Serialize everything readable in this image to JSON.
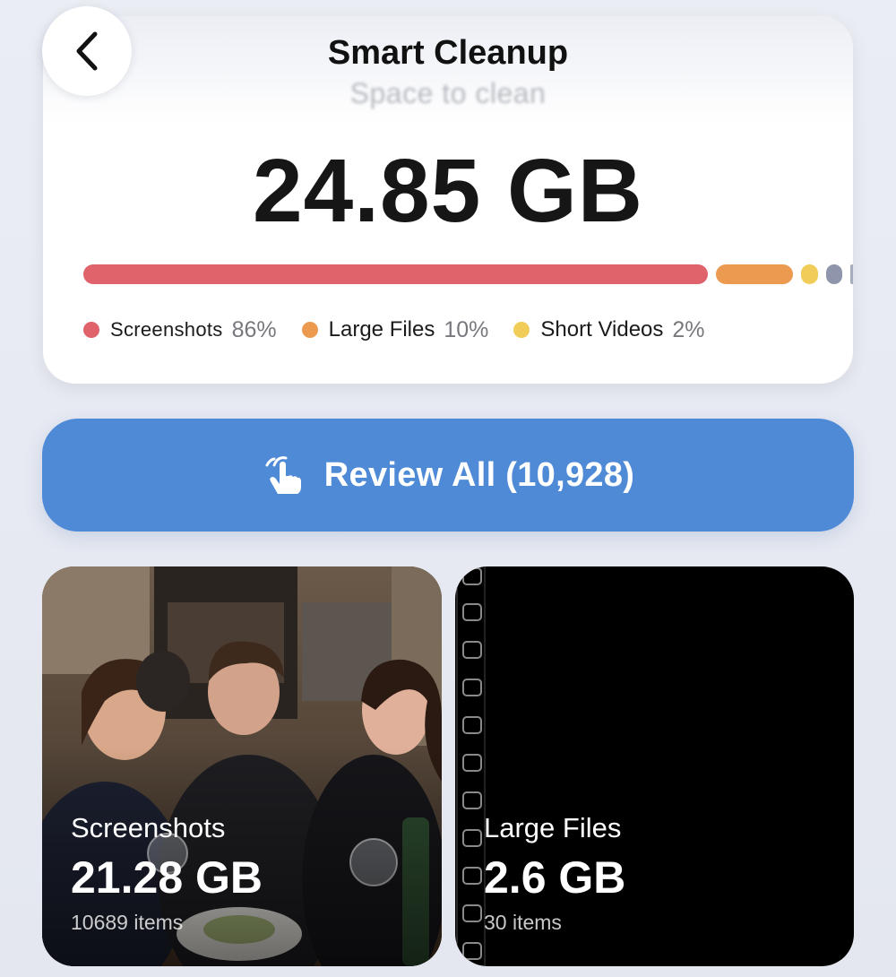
{
  "header": {
    "title": "Smart Cleanup",
    "back_icon": "chevron-left-icon"
  },
  "summary": {
    "subtitle": "Space to clean",
    "total": "24.85 GB",
    "breakdown": [
      {
        "name": "Screenshots",
        "percent": "86%",
        "color": "#e0626a"
      },
      {
        "name": "Large Files",
        "percent": "10%",
        "color": "#ec9a4f"
      },
      {
        "name": "Short Videos",
        "percent": "2%",
        "color": "#f1cc59"
      }
    ],
    "extra_segment_colors": [
      "#8f96ab",
      "#a6acbd"
    ]
  },
  "review_button": {
    "label": "Review All (10,928)",
    "icon": "tap-hand-icon",
    "color": "#4f8ad7"
  },
  "tiles": [
    {
      "name": "Screenshots",
      "size": "21.28 GB",
      "count": "10689 items"
    },
    {
      "name": "Large Files",
      "size": "2.6 GB",
      "count": "30 items"
    }
  ]
}
